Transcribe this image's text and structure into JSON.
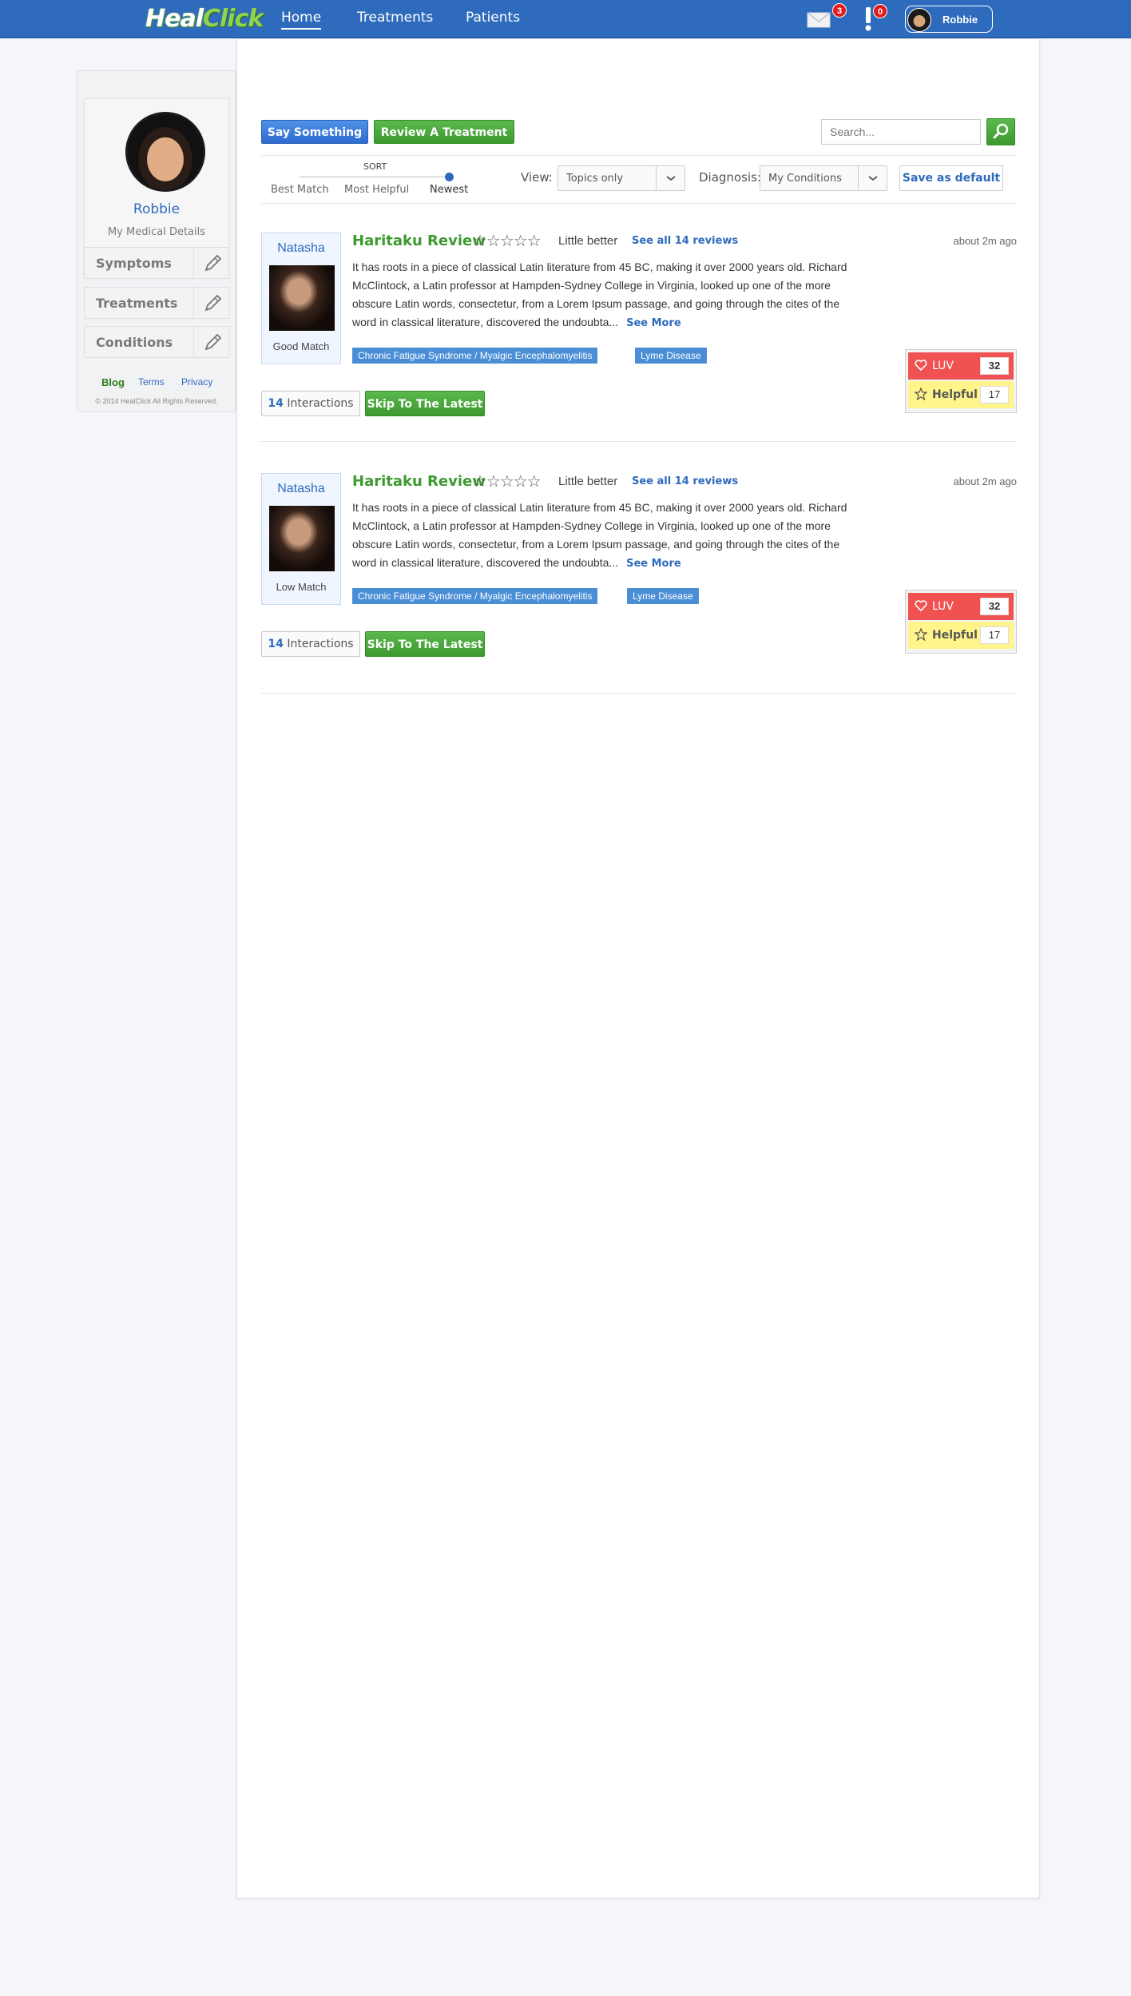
{
  "nav": {
    "logo": {
      "part1": "Heal",
      "part2": "Click"
    },
    "links": [
      "Home",
      "Treatments",
      "Patients"
    ],
    "messages_count": "3",
    "alerts_count": "0",
    "user_name": "Robbie"
  },
  "sidebar": {
    "profile_name": "Robbie",
    "medical_title": "My Medical Details",
    "items": [
      "Symptoms",
      "Treatments",
      "Conditions"
    ],
    "footer_links": [
      "Blog",
      "Terms",
      "Privacy"
    ],
    "copyright": "© 2014 HealClick All Rights Reserved."
  },
  "toolbar": {
    "say_something": "Say Something",
    "review_treatment": "Review A Treatment",
    "search_placeholder": "Search..."
  },
  "filters": {
    "sort_title": "SORT",
    "sort_options": [
      "Best Match",
      "Most Helpful",
      "Newest"
    ],
    "sort_selected": "Newest",
    "view_label": "View:",
    "view_value": "Topics only",
    "diagnosis_label": "Diagnosis:",
    "diagnosis_value": "My Conditions",
    "save_default": "Save as default"
  },
  "posts": [
    {
      "author": "Natasha",
      "match": "Good Match",
      "title": "Haritaku Review",
      "stars": "☆☆☆☆☆",
      "rating_word": "Little better",
      "see_all": "See all 14 reviews",
      "time": "about 2m ago",
      "body": "It has roots in a piece of classical Latin literature from 45 BC, making it over 2000 years old. Richard McClintock, a Latin professor at Hampden-Sydney College in Virginia, looked up one of the more obscure Latin words, consectetur, from a Lorem Ipsum passage, and going through the cites of the word in classical literature, discovered the undoubta...",
      "see_more": "See More",
      "tags": [
        "Chronic Fatigue Syndrome / Myalgic Encephalomyelitis",
        "Lyme Disease"
      ],
      "interactions_count": "14",
      "interactions_label": "Interactions",
      "skip_label": "Skip To The Latest",
      "luv_label": "LUV",
      "luv_count": "32",
      "helpful_label": "Helpful",
      "helpful_count": "17"
    },
    {
      "author": "Natasha",
      "match": "Low Match",
      "title": "Haritaku Review",
      "stars": "☆☆☆☆☆",
      "rating_word": "Little better",
      "see_all": "See all 14 reviews",
      "time": "about 2m ago",
      "body": "It has roots in a piece of classical Latin literature from 45 BC, making it over 2000 years old. Richard McClintock, a Latin professor at Hampden-Sydney College in Virginia, looked up one of the more obscure Latin words, consectetur, from a Lorem Ipsum passage, and going through the cites of the word in classical literature, discovered the undoubta...",
      "see_more": "See More",
      "tags": [
        "Chronic Fatigue Syndrome / Myalgic Encephalomyelitis",
        "Lyme Disease"
      ],
      "interactions_count": "14",
      "interactions_label": "Interactions",
      "skip_label": "Skip To The Latest",
      "luv_label": "LUV",
      "luv_count": "32",
      "helpful_label": "Helpful",
      "helpful_count": "17"
    }
  ],
  "colors": {
    "brand_blue": "#2f6bbd",
    "brand_green": "#3c9a2f",
    "luv_red": "#f05252",
    "helpful_yellow": "#fff58a",
    "tag_blue": "#4a8ed6"
  }
}
